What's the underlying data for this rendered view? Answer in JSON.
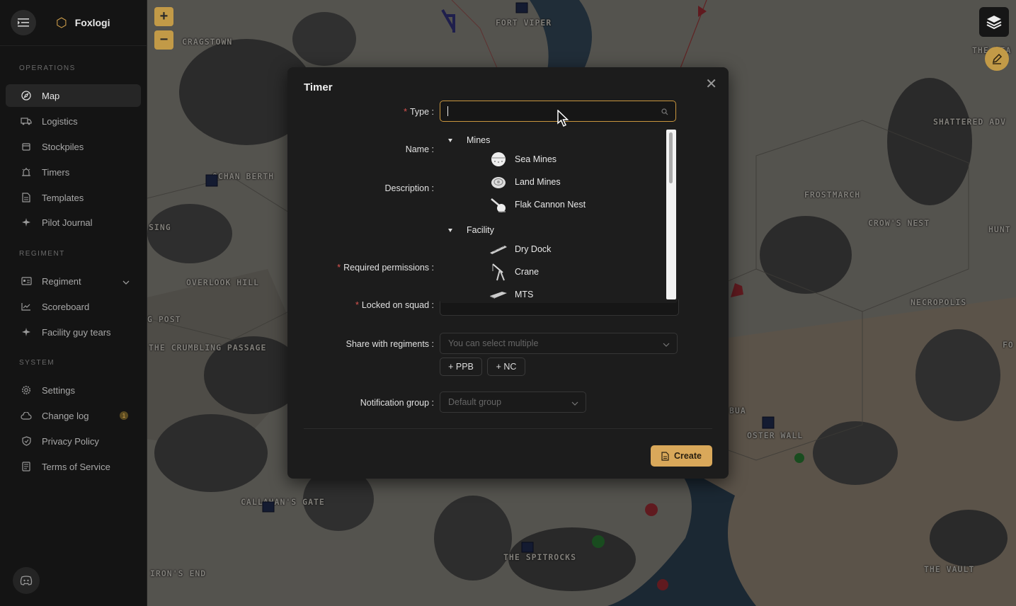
{
  "app": {
    "name": "Foxlogi"
  },
  "sidebar": {
    "sections": [
      {
        "heading": "OPERATIONS"
      },
      {
        "heading": "REGIMENT"
      },
      {
        "heading": "SYSTEM"
      }
    ],
    "items": [
      {
        "label": "Map",
        "icon": "compass-icon",
        "active": true
      },
      {
        "label": "Logistics",
        "icon": "truck-icon"
      },
      {
        "label": "Stockpiles",
        "icon": "box-icon"
      },
      {
        "label": "Timers",
        "icon": "alarm-icon"
      },
      {
        "label": "Templates",
        "icon": "file-icon"
      },
      {
        "label": "Pilot Journal",
        "icon": "plane-icon"
      },
      {
        "label": "Regiment",
        "icon": "id-card-icon",
        "expandable": true
      },
      {
        "label": "Scoreboard",
        "icon": "line-chart-icon"
      },
      {
        "label": "Facility guy tears",
        "icon": "plane-icon"
      },
      {
        "label": "Settings",
        "icon": "gear-icon"
      },
      {
        "label": "Change log",
        "icon": "cloud-icon",
        "badge": "1"
      },
      {
        "label": "Privacy Policy",
        "icon": "shield-icon"
      },
      {
        "label": "Terms of Service",
        "icon": "document-icon"
      }
    ]
  },
  "map": {
    "labels": [
      "FORT VIPER",
      "CRAGSTOWN",
      "OCHAN BERTH",
      "SING",
      "OVERLOOK HILL",
      "G POST",
      "THE CRUMBLING PASSAGE",
      "SHATTERED ADV",
      "FROSTMARCH",
      "CROW'S NEST",
      "HUNT",
      "NECROPOLIS",
      "FO",
      "BUA",
      "OSTER WALL",
      "CALLAHAN'S GATE",
      "THE SPITROCKS",
      "IRON'S END",
      "THE VAULT",
      "THE HEA"
    ],
    "zoom_in": "+",
    "zoom_out": "−"
  },
  "modal": {
    "title": "Timer",
    "fields": {
      "type": {
        "label": "Type",
        "value": ""
      },
      "name": {
        "label": "Name"
      },
      "description": {
        "label": "Description"
      },
      "permissions": {
        "label": "Required permissions"
      },
      "squad": {
        "label": "Locked on squad"
      },
      "share": {
        "label": "Share with regiments",
        "placeholder": "You can select multiple"
      },
      "notification": {
        "label": "Notification group",
        "placeholder": "Default group"
      }
    },
    "tags": [
      "+ PPB",
      "+ NC"
    ],
    "dropdown": {
      "groups": [
        {
          "label": "Mines",
          "items": [
            "Sea Mines",
            "Land Mines",
            "Flak Cannon Nest"
          ]
        },
        {
          "label": "Facility",
          "items": [
            "Dry Dock",
            "Crane",
            "MTS"
          ]
        }
      ]
    },
    "create_label": "Create",
    "colors": {
      "accent": "#d9a85a",
      "required": "#d9534f"
    }
  }
}
